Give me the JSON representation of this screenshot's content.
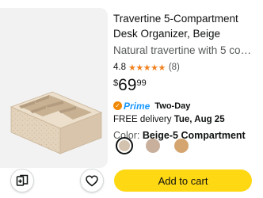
{
  "product": {
    "title_line1": "Travertine 5-Compartment",
    "title_line2": "Desk Organizer, Beige",
    "description": "Natural travertine with 5 compartments",
    "rating_value": "4.8",
    "stars_glyph": "★★★★★",
    "rating_count": "(8)",
    "price_symbol": "$",
    "price_whole": "69",
    "price_fraction": "99",
    "prime_check": "✓",
    "prime_label": "Prime",
    "prime_tag": "Two-Day",
    "delivery_prefix": "FREE delivery",
    "delivery_date": "Tue, Aug 25",
    "color_label": "Color:",
    "color_value": "Beige-5 Compartment"
  },
  "swatches": [
    {
      "color": "#d3c2ad",
      "selected": true
    },
    {
      "color": "#c8b09c",
      "selected": false
    },
    {
      "color": "#d4a56f",
      "selected": false
    }
  ],
  "actions": {
    "add_to_cart_label": "Add to cart",
    "compare_icon": "compare-icon",
    "wishlist_icon": "heart-icon"
  },
  "colors": {
    "cart_button": "#ffd814",
    "star": "#f1811e",
    "prime_blue": "#1a98ff",
    "image_panel": "#f2f2f2"
  }
}
